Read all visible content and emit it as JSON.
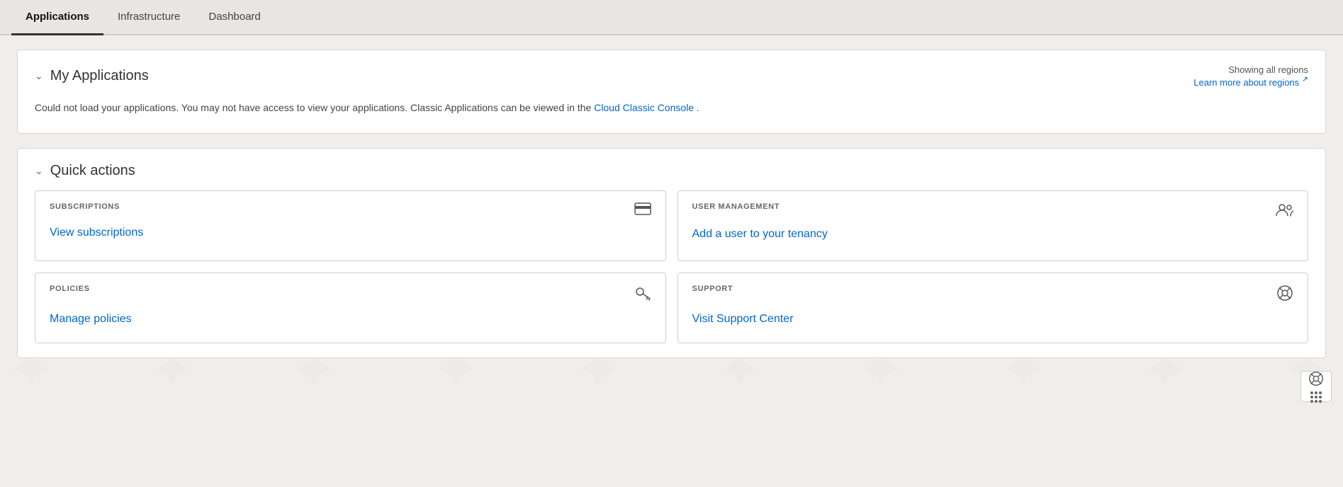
{
  "nav": {
    "tabs": [
      {
        "id": "applications",
        "label": "Applications",
        "active": true
      },
      {
        "id": "infrastructure",
        "label": "Infrastructure",
        "active": false
      },
      {
        "id": "dashboard",
        "label": "Dashboard",
        "active": false
      }
    ]
  },
  "myApplications": {
    "title": "My Applications",
    "regionLabel": "Showing all regions",
    "learnMoreLabel": "Learn more about regions",
    "errorMessage": "Could not load your applications. You may not have access to view your applications. Classic Applications can be viewed in the",
    "consoleLinkText": "Cloud Classic Console",
    "errorMessageSuffix": "."
  },
  "quickActions": {
    "title": "Quick actions",
    "cards": [
      {
        "category": "SUBSCRIPTIONS",
        "linkText": "View subscriptions",
        "icon": "credit-card"
      },
      {
        "category": "USER MANAGEMENT",
        "linkText": "Add a user to your tenancy",
        "icon": "users"
      },
      {
        "category": "POLICIES",
        "linkText": "Manage policies",
        "icon": "key"
      },
      {
        "category": "SUPPORT",
        "linkText": "Visit Support Center",
        "icon": "lifebuoy"
      }
    ]
  },
  "floatingSupport": {
    "icon": "lifebuoy"
  }
}
